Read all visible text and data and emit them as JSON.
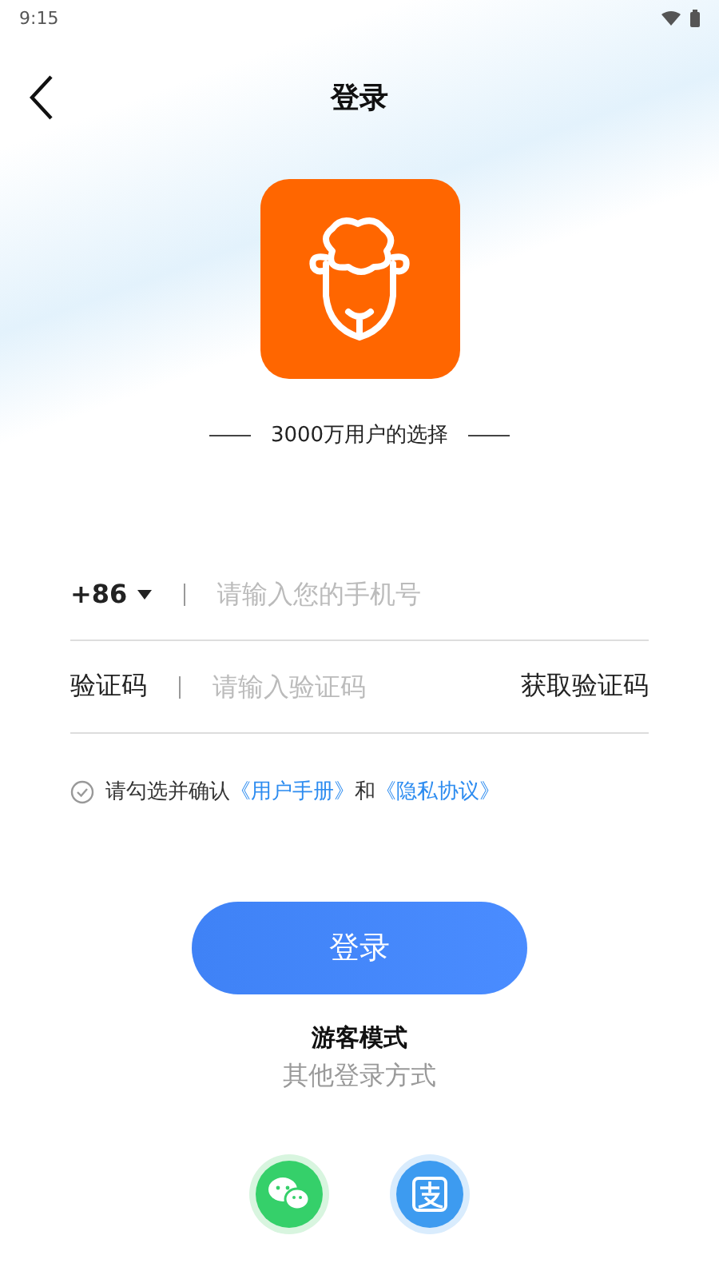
{
  "status_bar": {
    "time": "9:15"
  },
  "nav": {
    "title": "登录"
  },
  "tagline": "3000万用户的选择",
  "phone": {
    "country_code": "+86",
    "placeholder": "请输入您的手机号"
  },
  "code": {
    "label": "验证码",
    "placeholder": "请输入验证码",
    "action": "获取验证码"
  },
  "agreement": {
    "checked": false,
    "prefix": "请勾选并确认",
    "link1": "《用户手册》",
    "joiner": "和",
    "link2": "《隐私协议》"
  },
  "login_button": "登录",
  "guest_mode": "游客模式",
  "other_login": "其他登录方式",
  "social": [
    {
      "kind": "wechat"
    },
    {
      "kind": "alipay"
    }
  ]
}
